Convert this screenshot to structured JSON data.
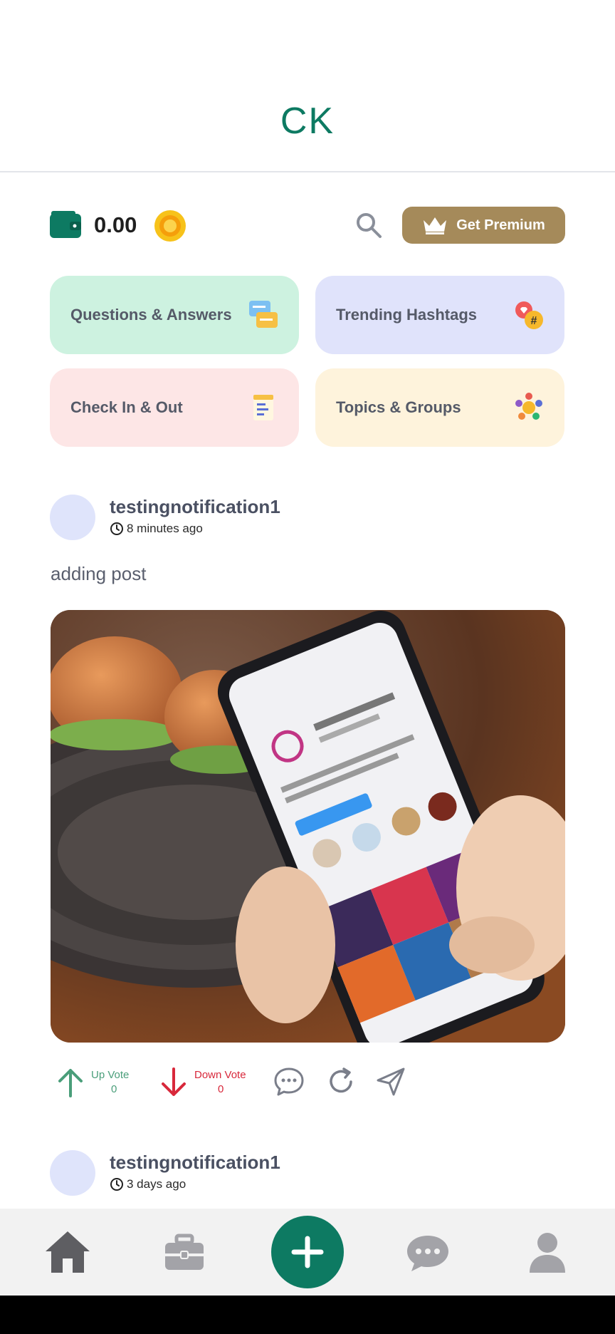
{
  "header": {
    "title": "CK"
  },
  "wallet": {
    "balance": "0.00",
    "premium_label": "Get Premium"
  },
  "tiles": [
    {
      "label": "Questions & Answers",
      "bg": "#cdf2e0"
    },
    {
      "label": "Trending Hashtags",
      "bg": "#e0e3fb"
    },
    {
      "label": "Check In & Out",
      "bg": "#fde6e6"
    },
    {
      "label": "Topics & Groups",
      "bg": "#fef3dc"
    }
  ],
  "posts": [
    {
      "username": "testingnotification1",
      "time": "8 minutes ago",
      "text": "adding post",
      "upvote_label": "Up Vote",
      "upvotes": "0",
      "downvote_label": "Down Vote",
      "downvotes": "0"
    },
    {
      "username": "testingnotification1",
      "time": "3 days ago"
    }
  ],
  "colors": {
    "brand": "#0d7a62",
    "premium": "#a58a5a",
    "upvote": "#4a9e7a",
    "downvote": "#d8283b"
  },
  "icons": {
    "wallet": "wallet-icon",
    "coin": "coin-icon",
    "search": "search-icon",
    "crown": "crown-icon",
    "nav": [
      "home-icon",
      "briefcase-icon",
      "plus-icon",
      "chat-icon",
      "profile-icon"
    ]
  }
}
